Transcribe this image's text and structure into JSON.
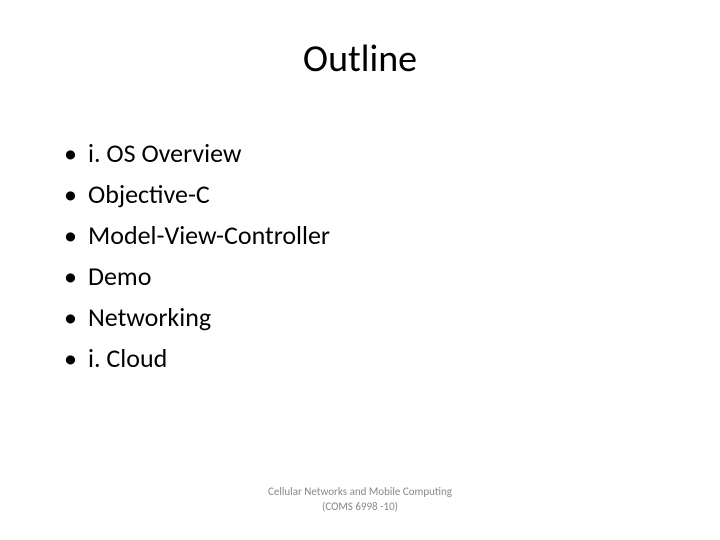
{
  "title": "Outline",
  "bullets": [
    "i. OS Overview",
    "Objective-C",
    "Model-View-Controller",
    "Demo",
    "Networking",
    "i. Cloud"
  ],
  "footer_line1": "Cellular Networks and Mobile Computing",
  "footer_line2": "(COMS 6998 -10)"
}
